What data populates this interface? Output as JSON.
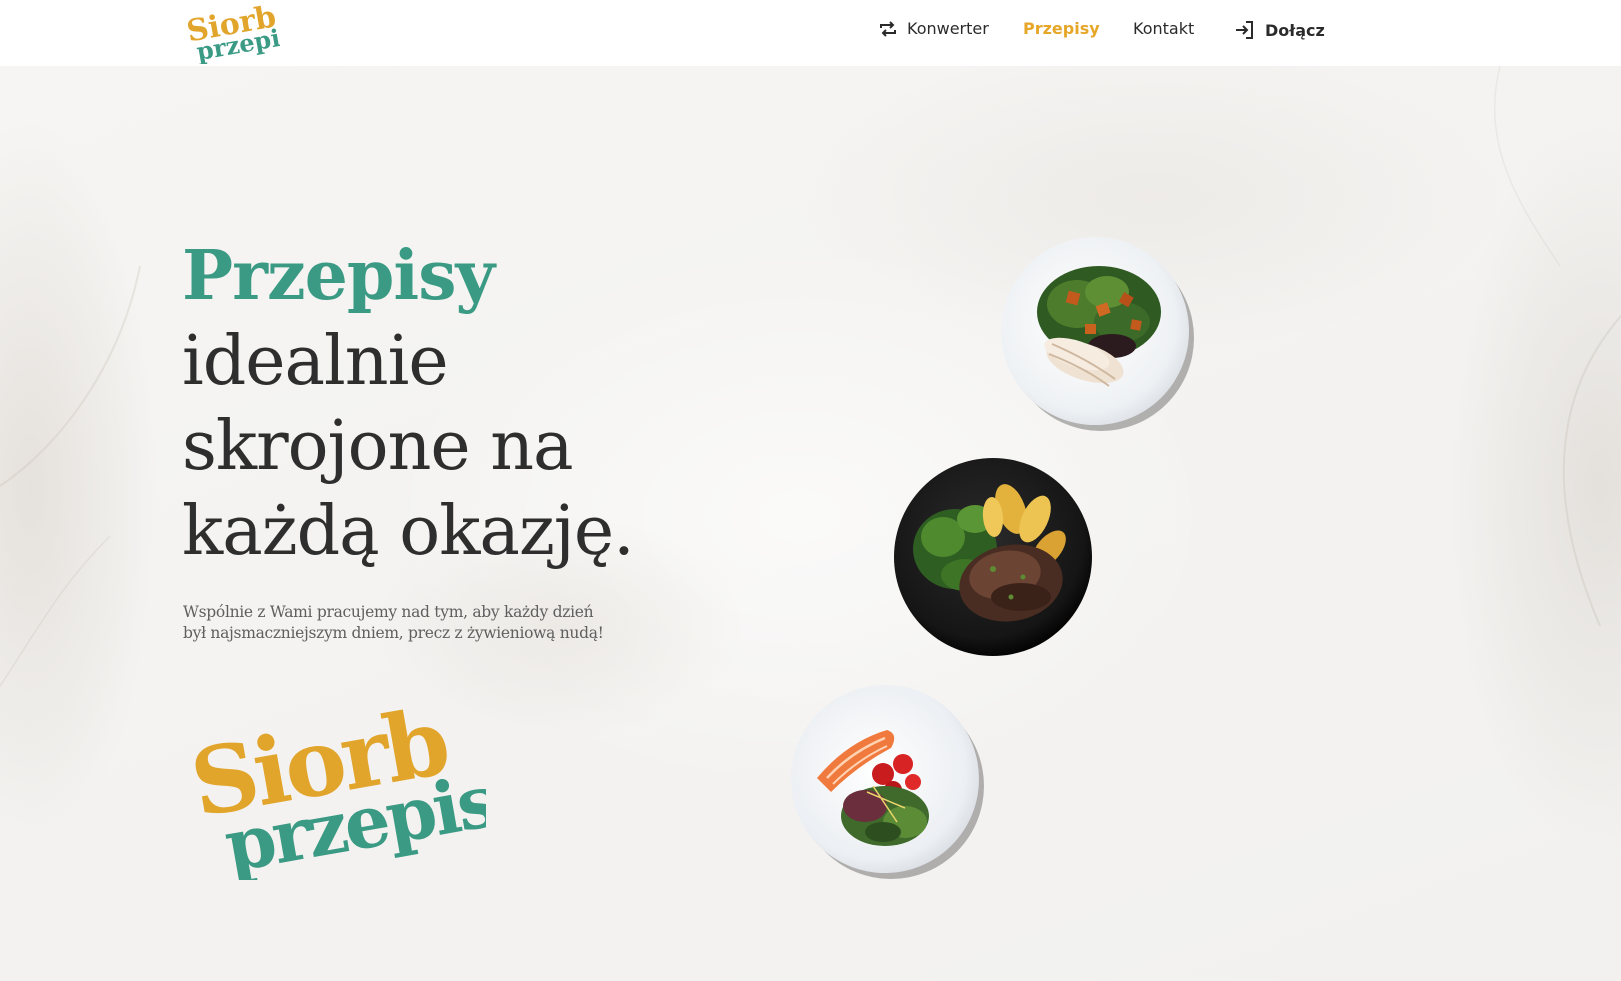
{
  "brand": {
    "logo_top": "Siorb",
    "logo_bottom": "przepisy",
    "colors": {
      "gold": "#e2a52c",
      "teal": "#3a9a84",
      "text": "#2e2e2e"
    }
  },
  "nav": {
    "converter": {
      "label": "Konwerter",
      "icon": "repeat-icon"
    },
    "recipes": {
      "label": "Przepisy",
      "active": true
    },
    "contact": {
      "label": "Kontakt"
    },
    "join": {
      "label": "Dołącz",
      "icon": "sign-in-icon"
    }
  },
  "hero": {
    "title_accent": "Przepisy",
    "title_line1": "idealnie",
    "title_line2": "skrojone na",
    "title_line3": "każdą okazję.",
    "subtitle": "Wspólnie z Wami pracujemy nad tym, aby każdy dzień był najsmaczniejszym dniem, precz z żywieniową nudą!"
  },
  "dishes": [
    {
      "name": "salad-with-chicken-plate"
    },
    {
      "name": "steak-with-potatoes-plate"
    },
    {
      "name": "salmon-with-salad-plate"
    }
  ]
}
